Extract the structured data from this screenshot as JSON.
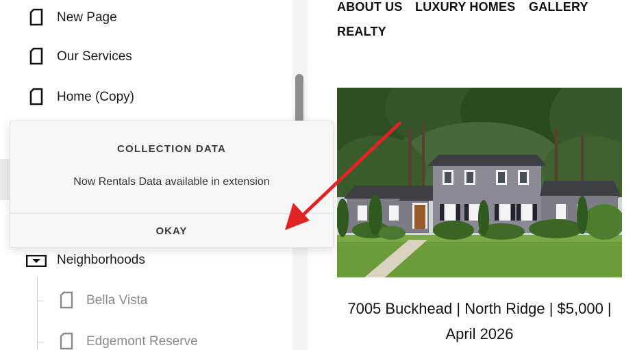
{
  "sidebar": {
    "items": [
      {
        "label": "New Page",
        "icon": "page-icon"
      },
      {
        "label": "Our Services",
        "icon": "page-icon"
      },
      {
        "label": "Home (Copy)",
        "icon": "page-icon"
      },
      {
        "label": "Neighborhoods",
        "icon": "collection-folder-icon"
      },
      {
        "label": "Bella Vista",
        "icon": "page-icon"
      },
      {
        "label": "Edgemont Reserve",
        "icon": "page-icon"
      }
    ]
  },
  "modal": {
    "title": "COLLECTION DATA",
    "message": "Now Rentals Data available in extension",
    "button": "OKAY"
  },
  "topnav": {
    "items": [
      "ABOUT US",
      "LUXURY HOMES",
      "GALLERY",
      "REALTY"
    ]
  },
  "listing": {
    "caption_line1": "7005 Buckhead | North Ridge | $5,000 |",
    "caption_line2": "April 2026"
  },
  "colors": {
    "arrow": "#e02424",
    "sidebar_bg": "#ffffff",
    "modal_bg": "#f6f6f6"
  }
}
